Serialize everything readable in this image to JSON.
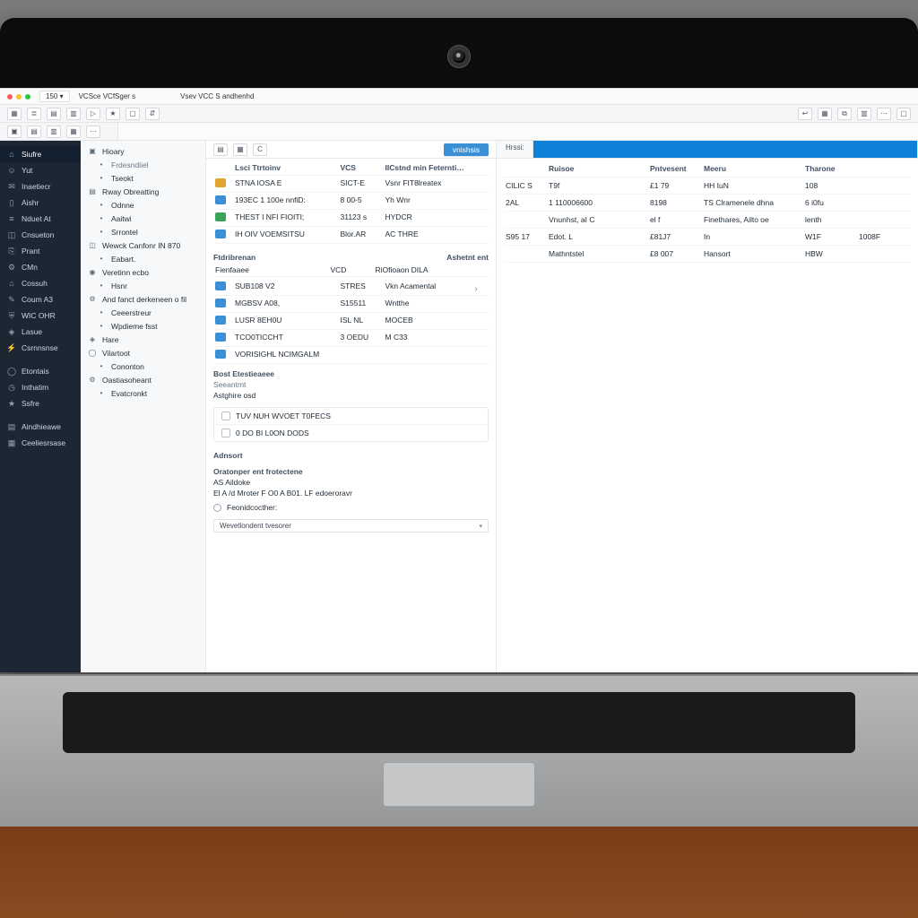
{
  "colors": {
    "accent": "#3b8fd6",
    "sidebar_bg": "#1c2733"
  },
  "tabs": {
    "badge": "150 ▾",
    "a": "VCSce   VCfSger s",
    "b": "Vsev  VCC S andhenhd"
  },
  "toolbar": {
    "icons": [
      "grid",
      "list",
      "layers",
      "cols",
      "play",
      "star",
      "box",
      "sort"
    ],
    "right_icons": [
      "back",
      "grid",
      "copy",
      "cols",
      "dots",
      "box"
    ]
  },
  "subtoolbar": {
    "icons": [
      "a",
      "b",
      "c",
      "d",
      "e"
    ]
  },
  "sidebar": {
    "items": [
      {
        "icon": "home-icon",
        "label": "Siufre"
      },
      {
        "icon": "person-icon",
        "label": "Yut"
      },
      {
        "icon": "chat-icon",
        "label": "Inaetiecr"
      },
      {
        "icon": "file-icon",
        "label": "Aishr"
      },
      {
        "icon": "bars-icon",
        "label": "Nduet At"
      },
      {
        "icon": "cube-icon",
        "label": "Cnsueton"
      },
      {
        "icon": "clip-icon",
        "label": "Prant"
      },
      {
        "icon": "gear-icon",
        "label": "CMn"
      },
      {
        "icon": "cart-icon",
        "label": "Cossuh"
      },
      {
        "icon": "wrench-icon",
        "label": "Coum A3"
      },
      {
        "icon": "shield-icon",
        "label": "WIC OHR"
      },
      {
        "icon": "tag-icon",
        "label": "Lasue"
      },
      {
        "icon": "bolt-icon",
        "label": "Csrnnsnse"
      },
      {
        "icon": "ring-icon",
        "label": "Etontais"
      },
      {
        "icon": "clock-icon",
        "label": "Inthatim"
      },
      {
        "icon": "star-icon",
        "label": "Ssfre"
      },
      {
        "icon": "layers-icon",
        "label": "Aindhieawe"
      },
      {
        "icon": "grid-icon",
        "label": "Ceeliesrsase"
      }
    ]
  },
  "tree": {
    "items": [
      {
        "icon": "folder-icon",
        "label": "Hioary",
        "ind": 0
      },
      {
        "icon": "dot-icon",
        "label": "Frdesndiiel",
        "ind": 1,
        "muted": true
      },
      {
        "icon": "dot-icon",
        "label": "Tseokt",
        "ind": 1
      },
      {
        "icon": "layers-icon",
        "label": "Rway Obreatting",
        "ind": 0
      },
      {
        "icon": "dot-icon",
        "label": "Odnne",
        "ind": 1
      },
      {
        "icon": "dot-icon",
        "label": "Aaitwi",
        "ind": 1
      },
      {
        "icon": "dot-icon",
        "label": "Srrontel",
        "ind": 1
      },
      {
        "icon": "cube-icon",
        "label": "Wewck Canfonr IN 870",
        "ind": 0
      },
      {
        "icon": "dot-icon",
        "label": "Eabart.",
        "ind": 1
      },
      {
        "icon": "eye-icon",
        "label": "Veretinn ecbo",
        "ind": 0
      },
      {
        "icon": "dot-icon",
        "label": "Hsnr",
        "ind": 1
      },
      {
        "icon": "gear-icon",
        "label": "And fanct derkeneen o fil",
        "ind": 0
      },
      {
        "icon": "dot-icon",
        "label": "Ceeerstreur",
        "ind": 1
      },
      {
        "icon": "dot-icon",
        "label": "Wpdieme fsst",
        "ind": 1
      },
      {
        "icon": "tag-icon",
        "label": "Hare",
        "ind": 0
      },
      {
        "icon": "ring-icon",
        "label": "Vilartoot",
        "ind": 0
      },
      {
        "icon": "dot-icon",
        "label": "Cononton",
        "ind": 1
      },
      {
        "icon": "gear-icon",
        "label": "Oastiasoheant",
        "ind": 0
      },
      {
        "icon": "dot-icon",
        "label": "Evatcronkt",
        "ind": 1
      }
    ]
  },
  "center": {
    "toolbar": {
      "icons": [
        "a",
        "b",
        "c"
      ],
      "primary": "vnishsis"
    },
    "grid1": {
      "headers": [
        "",
        "Lsci Ttrtoinv",
        "VCS",
        "IICstnd min Feternti…"
      ],
      "rows": [
        {
          "ic": "y",
          "a": "STNA IOSA E",
          "b": "SICT-E",
          "c": "Vsnr FIT8lreatex"
        },
        {
          "ic": "b",
          "a": "193EC 1 100e nnfiD:",
          "b": "8 00-5",
          "c": "Yh Wnr"
        },
        {
          "ic": "g",
          "a": "THEST I NFI FIOITI;",
          "b": "31123 s",
          "c": "HYDCR"
        },
        {
          "ic": "b",
          "a": "IH OIV VOEMSITSU",
          "b": "Blor.AR",
          "c": "AC THRE"
        }
      ]
    },
    "kv_headers": {
      "a": "Ftdribrenan",
      "b": "",
      "c": "Ashetnt ent"
    },
    "kv_sub": {
      "a": "Fienfaaee",
      "b": "VCD",
      "c": "RiOfioaon DILA"
    },
    "grid2": {
      "rows": [
        {
          "ic": "b",
          "a": "SUB108 V2",
          "b": "STRES",
          "c": "Vkn  Acamental"
        },
        {
          "ic": "b",
          "a": "MGBSV A08,",
          "b": "S15511",
          "c": "Wntthe"
        },
        {
          "ic": "b",
          "a": "LUSR 8EH0U",
          "b": "ISL NL",
          "c": "MOCEB"
        },
        {
          "ic": "b",
          "a": "TCO0TICCHT",
          "b": "3 OEDU",
          "c": "M C33"
        },
        {
          "ic": "b",
          "a": "VORISIGHL NCIMGALM",
          "b": "",
          "c": ""
        }
      ]
    },
    "sec1": "Bost  Etestieaeee",
    "sec1_sub": "Seeantmt",
    "sec1_line": "Astghire osd",
    "box1": {
      "a": "TUV NUH WVOET T0FECS",
      "b": "0 DO BI  L0ON DODS"
    },
    "sec2": "Adnsort",
    "sec3": "Oratonper ent  frotectene",
    "sec3_l2": "AS Aildoke",
    "sec3_l3": "El A /d Mroter    F O0 A  B01.  LF  edoeroravr",
    "radio_a": "Feonidcocther:",
    "select_value": "Wevetlondent  tvesorer"
  },
  "rpanel": {
    "tab_a": "Hrssi:",
    "tab_active": "",
    "headers": [
      "",
      "Ruisoe",
      "Pntvesent",
      "Meeru",
      "Tharone",
      ""
    ],
    "rows": [
      {
        "a": "CILIC S",
        "b": "T9f",
        "c": "£1 79",
        "d": "HH  IuN",
        "e": "108",
        "f": ""
      },
      {
        "a": "2AL",
        "b": "1 110006600",
        "c": "8198",
        "d": "TS Clramenele dhna",
        "e": "6 i0fu",
        "f": ""
      },
      {
        "a": "",
        "b": "Vnunhst, aI C",
        "c": "el f",
        "d": "Finethares, Ailto oe",
        "e": "lenth",
        "f": ""
      },
      {
        "a": "S95 17",
        "b": "Edot. L",
        "c": "£81J7",
        "d": "In",
        "e": "W1F",
        "f": "1008F"
      },
      {
        "a": "",
        "b": "Mathntstel",
        "c": "£8 007",
        "d": "Hansort",
        "e": "HBW",
        "f": ""
      }
    ]
  }
}
